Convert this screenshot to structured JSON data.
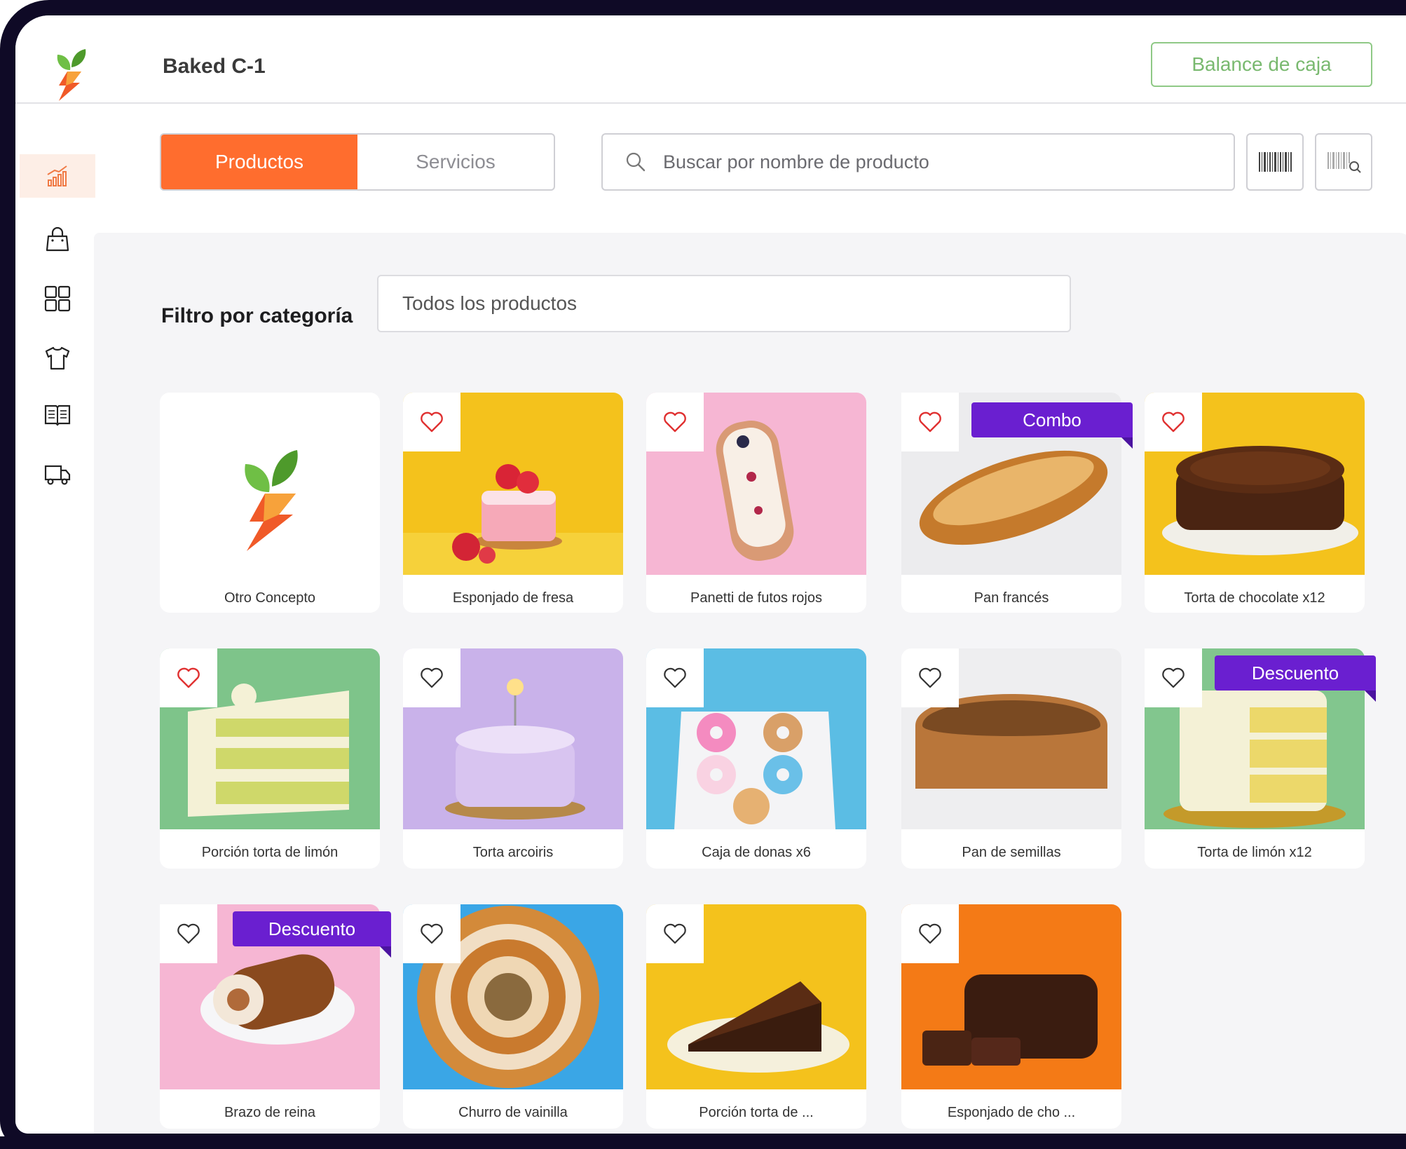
{
  "header": {
    "store_name": "Baked C-1",
    "balance_button": "Balance de caja"
  },
  "sidebar": {
    "items": [
      {
        "icon": "chart-icon",
        "active": true
      },
      {
        "icon": "shopping-bag-icon",
        "active": false
      },
      {
        "icon": "grid-icon",
        "active": false
      },
      {
        "icon": "tshirt-icon",
        "active": false
      },
      {
        "icon": "book-icon",
        "active": false
      },
      {
        "icon": "truck-icon",
        "active": false
      }
    ]
  },
  "tabs": {
    "products": "Productos",
    "services": "Servicios"
  },
  "search": {
    "placeholder": "Buscar por nombre de producto"
  },
  "filter": {
    "label": "Filtro por categoría",
    "selected": "Todos los productos"
  },
  "colors": {
    "accent": "#ff6d2e",
    "badge": "#6a1fd0",
    "brand_green": "#79b96f",
    "heart_red": "#e03131"
  },
  "products": [
    {
      "name": "Otro Concepto",
      "favorite": false
    },
    {
      "name": "Esponjado de fresa",
      "favorite": true
    },
    {
      "name": "Panetti de futos rojos",
      "favorite": true
    },
    {
      "name": "Pan francés",
      "favorite": true,
      "badge": "Combo"
    },
    {
      "name": "Torta de chocolate x12",
      "favorite": true
    },
    {
      "name": "Porción torta de limón",
      "favorite": true
    },
    {
      "name": "Torta arcoiris",
      "favorite": false
    },
    {
      "name": "Caja de donas x6",
      "favorite": false
    },
    {
      "name": "Pan de semillas",
      "favorite": false
    },
    {
      "name": "Torta de limón x12",
      "favorite": false,
      "badge": "Descuento"
    },
    {
      "name": "Brazo de reina",
      "favorite": false,
      "badge": "Descuento"
    },
    {
      "name": "Churro de vainilla",
      "favorite": false
    },
    {
      "name": "Porción torta de ...",
      "favorite": false
    },
    {
      "name": "Esponjado de cho ...",
      "favorite": false
    }
  ]
}
